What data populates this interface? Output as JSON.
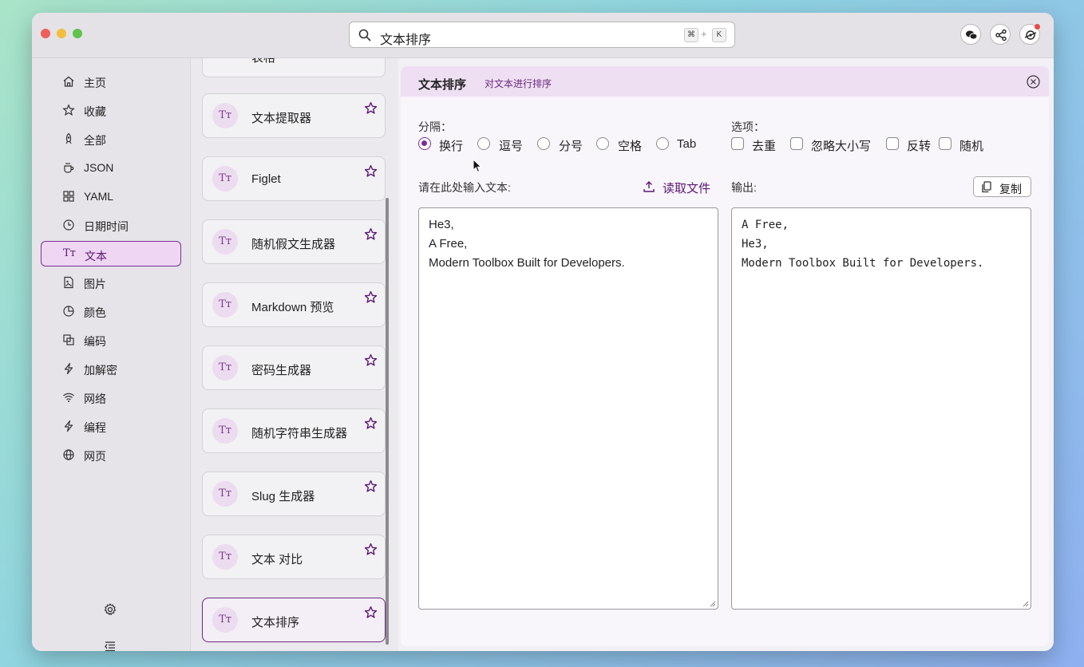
{
  "search": {
    "value": "文本排序",
    "kbd_cmd": "⌘",
    "kbd_plus": "+",
    "kbd_key": "K"
  },
  "toolbar_icons": [
    "wechat-icon",
    "share-icon",
    "settings-sync-icon"
  ],
  "sidebar": {
    "items": [
      {
        "label": "主页",
        "icon": "home-icon"
      },
      {
        "label": "收藏",
        "icon": "star-icon"
      },
      {
        "label": "全部",
        "icon": "rocket-icon"
      },
      {
        "label": "JSON",
        "icon": "coffee-icon"
      },
      {
        "label": "YAML",
        "icon": "grid-icon"
      },
      {
        "label": "日期时间",
        "icon": "clock-icon"
      },
      {
        "label": "文本",
        "icon": "text-icon",
        "active": true
      },
      {
        "label": "图片",
        "icon": "image-file-icon"
      },
      {
        "label": "颜色",
        "icon": "color-icon"
      },
      {
        "label": "编码",
        "icon": "code-icon"
      },
      {
        "label": "加解密",
        "icon": "bolt-icon"
      },
      {
        "label": "网络",
        "icon": "wifi-icon"
      },
      {
        "label": "编程",
        "icon": "bolt-icon"
      },
      {
        "label": "网页",
        "icon": "globe-icon"
      }
    ]
  },
  "tools": [
    {
      "label": "表格"
    },
    {
      "label": "文本提取器"
    },
    {
      "label": "Figlet"
    },
    {
      "label": "随机假文生成器"
    },
    {
      "label": "Markdown 预览"
    },
    {
      "label": "密码生成器"
    },
    {
      "label": "随机字符串生成器"
    },
    {
      "label": "Slug 生成器"
    },
    {
      "label": "文本 对比"
    },
    {
      "label": "文本排序",
      "active": true
    }
  ],
  "tool_icon_glyph": "Tт",
  "panel": {
    "title": "文本排序",
    "subtitle": "对文本进行排序",
    "separator_label": "分隔：",
    "separators": [
      {
        "label": "换行",
        "checked": true
      },
      {
        "label": "逗号",
        "checked": false
      },
      {
        "label": "分号",
        "checked": false
      },
      {
        "label": "空格",
        "checked": false
      },
      {
        "label": "Tab",
        "checked": false
      }
    ],
    "options_label": "选项：",
    "options": [
      {
        "label": "去重",
        "checked": false
      },
      {
        "label": "忽略大小写",
        "checked": false
      },
      {
        "label": "反转",
        "checked": false
      },
      {
        "label": "随机",
        "checked": false
      }
    ],
    "input_label": "请在此处输入文本:",
    "read_file_label": "读取文件",
    "output_label": "输出:",
    "copy_label": "复制",
    "input_text": "He3,\nA Free,\nModern Toolbox Built for Developers.",
    "output_text": "A Free,\nHe3,\nModern Toolbox Built for Developers."
  },
  "colors": {
    "accent": "#7c2e95",
    "panel_header": "#efdff3"
  }
}
